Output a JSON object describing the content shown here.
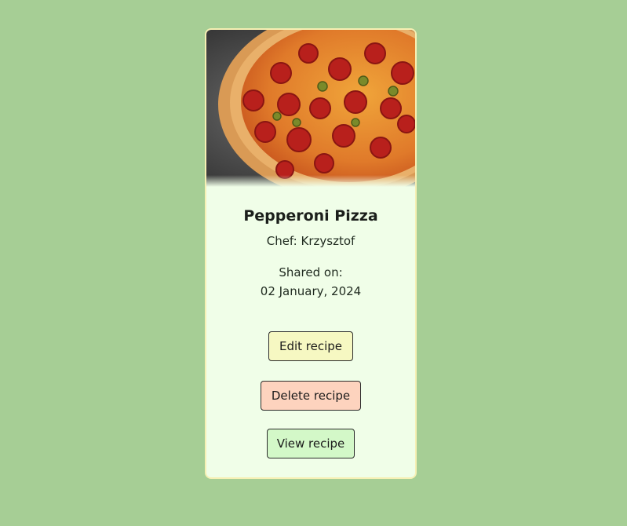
{
  "recipe": {
    "title": "Pepperoni Pizza",
    "chef": "Chef: Krzysztof",
    "shared_label": "Shared on:",
    "shared_date": "02 January, 2024",
    "image_icon": "pizza-photo"
  },
  "actions": {
    "edit_label": "Edit recipe",
    "delete_label": "Delete recipe",
    "view_label": "View recipe"
  },
  "colors": {
    "page_background": "#a6ce95",
    "card_background": "#f0fee8",
    "card_border": "#f6f0b4",
    "edit_button": "#f6f8c2",
    "delete_button": "#fdd3be",
    "view_button": "#d3f8c8"
  }
}
